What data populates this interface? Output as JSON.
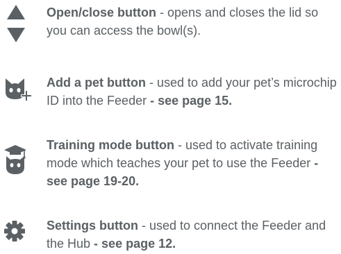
{
  "items": [
    {
      "icon": "up-down-arrows-icon",
      "title": "Open/close button",
      "description": " - opens and closes the lid so you can access the bowl(s).",
      "reference": ""
    },
    {
      "icon": "cat-face-plus-icon",
      "title": "Add a pet button",
      "description": " - used to add your pet’s microchip ID into the Feeder",
      "reference": " - see page 15."
    },
    {
      "icon": "cat-graduation-cap-icon",
      "title": "Training mode button",
      "description": " - used to activate training mode which teaches your pet to use the Feeder",
      "reference": " - see page 19-20."
    },
    {
      "icon": "gear-icon",
      "title": "Settings button",
      "description": " - used to connect the Feeder and the Hub",
      "reference": " - see page 12."
    }
  ],
  "colors": {
    "text": "#5a6064",
    "icon": "#5a6064"
  }
}
